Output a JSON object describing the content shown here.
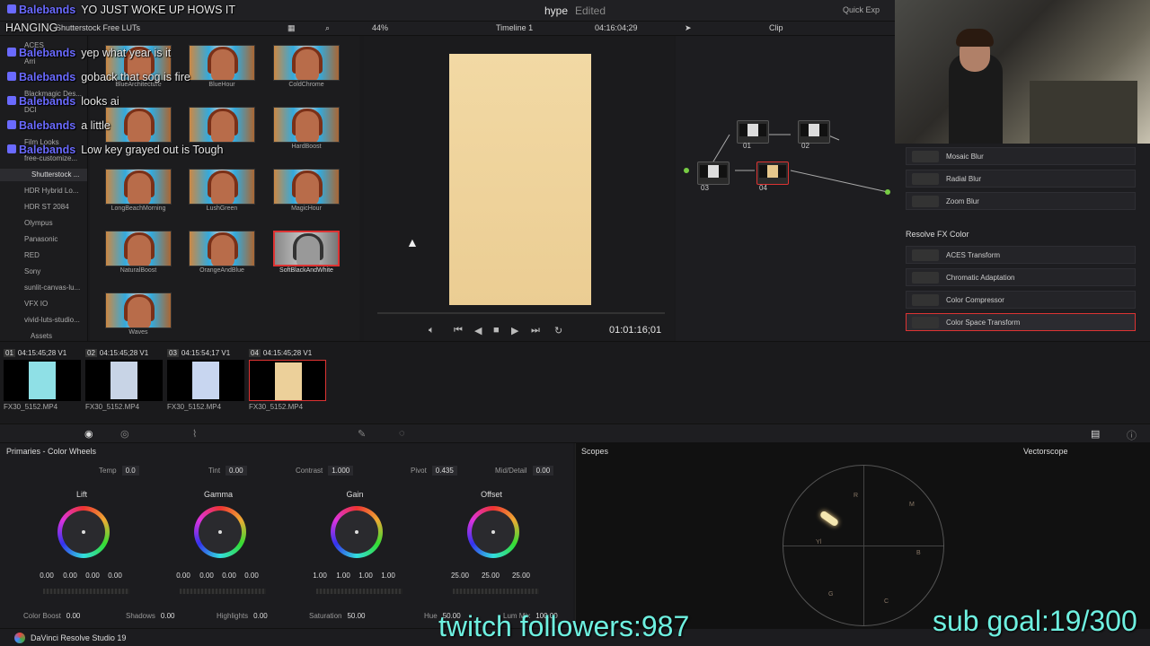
{
  "topbar": {
    "project": "hype",
    "status": "Edited",
    "quick": "Quick Exp"
  },
  "toolbar": {
    "lib_title": "Shutterstock Free  LUTs",
    "zoom": "44%",
    "timeline": "Timeline 1",
    "timecode": "04:16:04;29",
    "clip": "Clip"
  },
  "tree": [
    "ACES",
    "Arri",
    "",
    "Blackmagic Des...",
    "DCI",
    "",
    "Film Looks",
    "free-customize...",
    "Shutterstock ...",
    "HDR Hybrid Lo...",
    "HDR ST 2084",
    "Olympus",
    "Panasonic",
    "RED",
    "Sony",
    "sunlit-canvas-lu...",
    "VFX IO",
    "vivid-luts-studio...",
    "Assets"
  ],
  "luts": [
    "BlueArchitecture",
    "BlueHour",
    "ColdChrome",
    "",
    "",
    "HardBoost",
    "LongBeachMorning",
    "LushGreen",
    "MagicHour",
    "NaturalBoost",
    "OrangeAndBlue",
    "SoftBlackAndWhite",
    "Waves"
  ],
  "viewer": {
    "timecode": "01:01:16;01"
  },
  "nodes": [
    "01",
    "02",
    "03",
    "04"
  ],
  "fx": {
    "items_top": [
      "Mosaic Blur",
      "Radial Blur",
      "Zoom Blur"
    ],
    "section": "Resolve FX Color",
    "items": [
      "ACES Transform",
      "Chromatic Adaptation",
      "Color Compressor",
      "Color Space Transform"
    ]
  },
  "clips": [
    {
      "num": "01",
      "tc": "04:15:45;28",
      "track": "V1",
      "file": "FX30_5152.MP4",
      "color": "#8fe0e6"
    },
    {
      "num": "02",
      "tc": "04:15:45;28",
      "track": "V1",
      "file": "FX30_5152.MP4",
      "color": "#c8d4e6"
    },
    {
      "num": "03",
      "tc": "04:15:54;17",
      "track": "V1",
      "file": "FX30_5152.MP4",
      "color": "#c8d6f0"
    },
    {
      "num": "04",
      "tc": "04:15:45;28",
      "track": "V1",
      "file": "FX30_5152.MP4",
      "color": "#ecd09a"
    }
  ],
  "primaries": {
    "title": "Primaries - Color Wheels",
    "temp": "0.0",
    "tint": "0.00",
    "contrast": "1.000",
    "pivot": "0.435",
    "middetail": "0.00",
    "labels": {
      "temp": "Temp",
      "tint": "Tint",
      "contrast": "Contrast",
      "pivot": "Pivot",
      "middetail": "Mid/Detail"
    },
    "wheels": [
      {
        "name": "Lift",
        "vals": [
          "0.00",
          "0.00",
          "0.00",
          "0.00"
        ]
      },
      {
        "name": "Gamma",
        "vals": [
          "0.00",
          "0.00",
          "0.00",
          "0.00"
        ]
      },
      {
        "name": "Gain",
        "vals": [
          "1.00",
          "1.00",
          "1.00",
          "1.00"
        ]
      },
      {
        "name": "Offset",
        "vals": [
          "25.00",
          "25.00",
          "25.00"
        ]
      }
    ],
    "bottom": {
      "colorboost_l": "Color Boost",
      "colorboost": "0.00",
      "shadows_l": "Shadows",
      "shadows": "0.00",
      "highlights_l": "Highlights",
      "highlights": "0.00",
      "saturation_l": "Saturation",
      "saturation": "50.00",
      "hue_l": "Hue",
      "hue": "50.00",
      "lummix_l": "Lum Mix",
      "lummix": "100.00"
    }
  },
  "scopes": {
    "title": "Scopes",
    "mode": "Vectorscope",
    "targets": [
      "R",
      "M",
      "Yl",
      "B",
      "G",
      "C"
    ]
  },
  "app": "DaVinci Resolve Studio 19",
  "overlay": {
    "chat": [
      {
        "user": "Balebands",
        "msg": "YO JUST WOKE UP HOWS IT"
      },
      {
        "user": "",
        "msg": "HANGING"
      },
      {
        "user": "Balebands",
        "msg": "yep what year is it"
      },
      {
        "user": "Balebands",
        "msg": "goback that sog is fire"
      },
      {
        "user": "Balebands",
        "msg": "looks ai"
      },
      {
        "user": "Balebands",
        "msg": "a little"
      },
      {
        "user": "Balebands",
        "msg": "Low key grayed out is Tough"
      }
    ],
    "followers": "twitch followers:987",
    "subgoal": "sub goal:19/300"
  }
}
